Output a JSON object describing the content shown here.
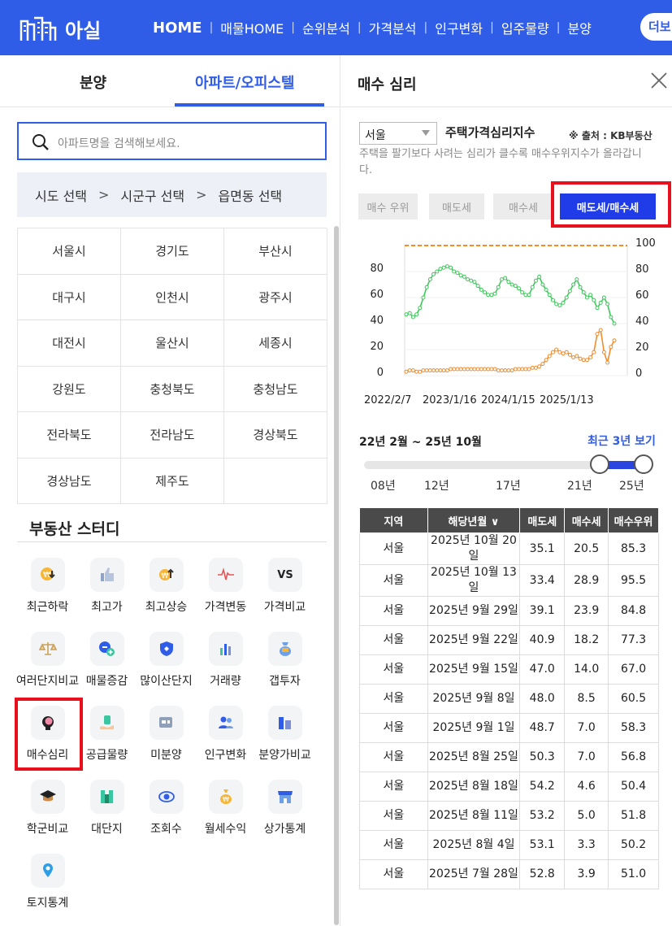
{
  "header": {
    "logo_text": "아실",
    "nav": [
      "HOME",
      "매물HOME",
      "순위분석",
      "가격분석",
      "인구변화",
      "입주물량",
      "분양"
    ],
    "more_label": "더보"
  },
  "left": {
    "tabs": [
      "분양",
      "아파트/오피스텔"
    ],
    "search_placeholder": "아파트명을 검색해보세요.",
    "region_steps": [
      "시도 선택",
      "시군구 선택",
      "읍면동 선택"
    ],
    "regions": [
      "서울시",
      "경기도",
      "부산시",
      "대구시",
      "인천시",
      "광주시",
      "대전시",
      "울산시",
      "세종시",
      "강원도",
      "충청북도",
      "충청남도",
      "전라북도",
      "전라남도",
      "경상북도",
      "경상남도",
      "제주도",
      ""
    ],
    "study_title": "부동산 스터디",
    "study_items": [
      {
        "label": "최근하락",
        "icon": "price-down-icon"
      },
      {
        "label": "최고가",
        "icon": "thumbs-up-icon"
      },
      {
        "label": "최고상승",
        "icon": "price-up-icon"
      },
      {
        "label": "가격변동",
        "icon": "pulse-icon"
      },
      {
        "label": "가격비교",
        "icon": "vs-icon"
      },
      {
        "label": "여러단지비교",
        "icon": "scale-icon"
      },
      {
        "label": "매물증감",
        "icon": "plus-minus-icon"
      },
      {
        "label": "많이산단지",
        "icon": "shield-icon"
      },
      {
        "label": "거래량",
        "icon": "bar-chart-icon"
      },
      {
        "label": "갭투자",
        "icon": "money-bag-icon"
      },
      {
        "label": "매수심리",
        "icon": "brain-icon"
      },
      {
        "label": "공급물량",
        "icon": "supply-hand-icon"
      },
      {
        "label": "미분양",
        "icon": "unsold-icon"
      },
      {
        "label": "인구변화",
        "icon": "people-icon"
      },
      {
        "label": "분양가비교",
        "icon": "building-icon"
      },
      {
        "label": "학군비교",
        "icon": "graduation-cap-icon"
      },
      {
        "label": "대단지",
        "icon": "complex-icon"
      },
      {
        "label": "조회수",
        "icon": "eye-icon"
      },
      {
        "label": "월세수익",
        "icon": "coin-bag-icon"
      },
      {
        "label": "상가통계",
        "icon": "store-icon"
      },
      {
        "label": "토지통계",
        "icon": "map-pin-icon"
      }
    ]
  },
  "right": {
    "title": "매수 심리",
    "region_select": "서울",
    "index_title": "주택가격심리지수",
    "source": "※ 출처 : KB부동산",
    "description": "주택을 팔기보다 사려는 심리가 클수록 매수우위지수가 올라갑니다.",
    "buttons": [
      "매수 우위",
      "매도세",
      "매수세",
      "매도세/매수세"
    ],
    "period_text": "22년 2월 ~ 25년 10월",
    "recent_label": "최근 3년 보기",
    "slider_years": [
      "08년",
      "12년",
      "17년",
      "21년",
      "25년"
    ],
    "table": {
      "headers": [
        "지역",
        "해당년월 ∨",
        "매도세",
        "매수세",
        "매수우위"
      ],
      "rows": [
        [
          "서울",
          "2025년 10월 20일",
          "35.1",
          "20.5",
          "85.3"
        ],
        [
          "서울",
          "2025년 10월 13일",
          "33.4",
          "28.9",
          "95.5"
        ],
        [
          "서울",
          "2025년 9월 29일",
          "39.1",
          "23.9",
          "84.8"
        ],
        [
          "서울",
          "2025년 9월 22일",
          "40.9",
          "18.2",
          "77.3"
        ],
        [
          "서울",
          "2025년 9월 15일",
          "47.0",
          "14.0",
          "67.0"
        ],
        [
          "서울",
          "2025년 9월 8일",
          "48.0",
          "8.5",
          "60.5"
        ],
        [
          "서울",
          "2025년 9월 1일",
          "48.7",
          "7.0",
          "58.3"
        ],
        [
          "서울",
          "2025년 8월 25일",
          "50.3",
          "7.0",
          "56.8"
        ],
        [
          "서울",
          "2025년 8월 18일",
          "54.2",
          "4.6",
          "50.4"
        ],
        [
          "서울",
          "2025년 8월 11일",
          "53.2",
          "5.0",
          "51.8"
        ],
        [
          "서울",
          "2025년 8월 4일",
          "53.1",
          "3.3",
          "50.2"
        ],
        [
          "서울",
          "2025년 7월 28일",
          "52.8",
          "3.9",
          "51.0"
        ]
      ]
    }
  },
  "chart_data": {
    "type": "line",
    "x_ticks": [
      "2022/2/7",
      "2023/1/16",
      "2024/1/15",
      "2025/1/13"
    ],
    "y_left_ticks": [
      0,
      20,
      40,
      60,
      80
    ],
    "y_right_ticks": [
      0,
      20,
      40,
      60,
      80,
      100
    ],
    "ylim": [
      0,
      100
    ],
    "reference_line": 100,
    "series": [
      {
        "color": "#3dc95a",
        "values": [
          47,
          48,
          45,
          47,
          52,
          60,
          68,
          74,
          78,
          80,
          82,
          83,
          84,
          83,
          80,
          79,
          77,
          76,
          74,
          73,
          72,
          69,
          66,
          64,
          62,
          62,
          63,
          68,
          74,
          75,
          72,
          70,
          69,
          67,
          64,
          62,
          62,
          68,
          73,
          76,
          70,
          66,
          62,
          58,
          55,
          54,
          56,
          60,
          65,
          70,
          74,
          68,
          64,
          60,
          62,
          58,
          52,
          56,
          60,
          55,
          45,
          40
        ]
      },
      {
        "color": "#f08c2e",
        "values": [
          3,
          4,
          4,
          3,
          3,
          4,
          4,
          4,
          4,
          4,
          4,
          4,
          4,
          5,
          5,
          5,
          5,
          5,
          5,
          5,
          5,
          5,
          5,
          5,
          5,
          5,
          5,
          4,
          4,
          4,
          4,
          4,
          5,
          5,
          5,
          5,
          5,
          6,
          6,
          7,
          9,
          12,
          15,
          18,
          20,
          18,
          17,
          18,
          16,
          14,
          15,
          13,
          12,
          12,
          14,
          18,
          32,
          35,
          18,
          10,
          22,
          27
        ]
      }
    ],
    "colors": {
      "green": "#3dc95a",
      "orange": "#f08c2e",
      "reference": "#f08c2e"
    }
  }
}
